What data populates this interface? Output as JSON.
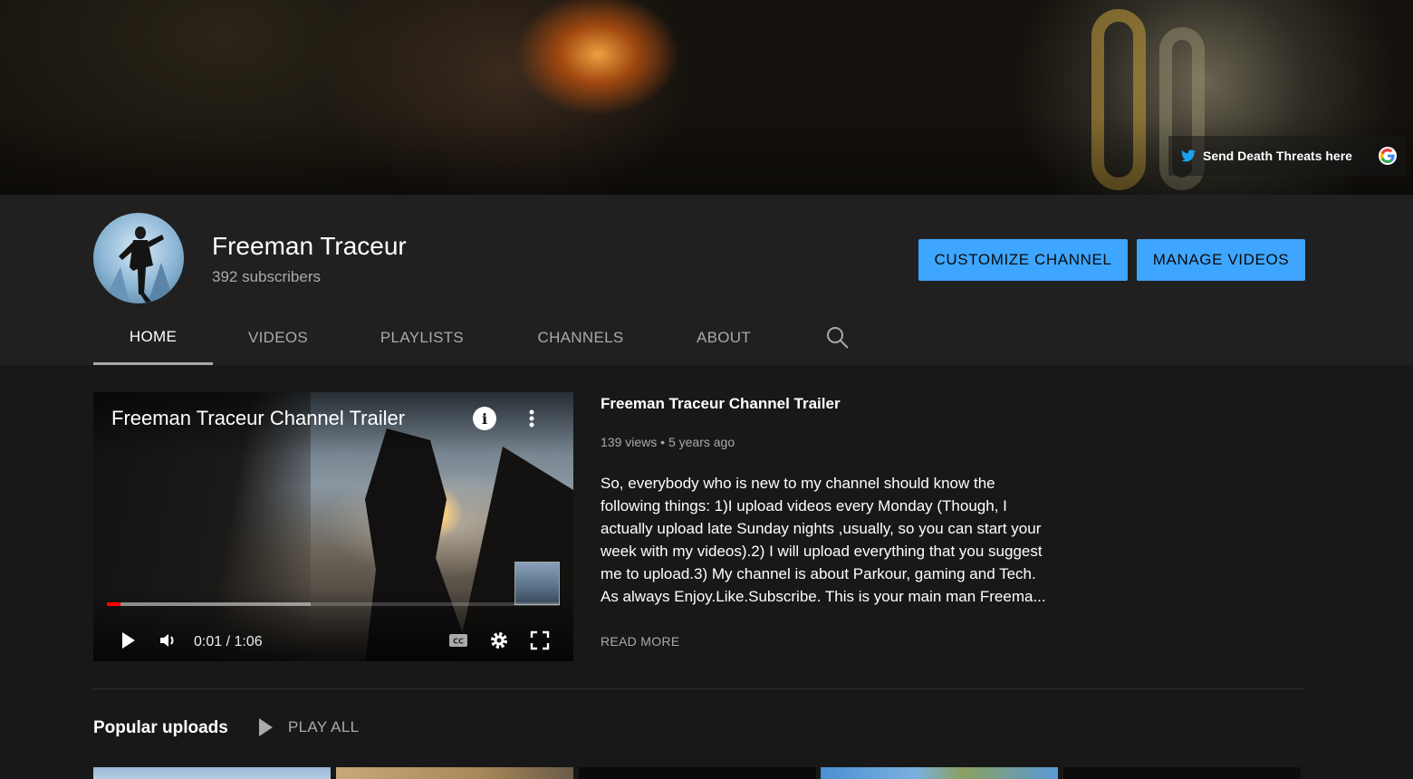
{
  "banner": {
    "link_label": "Send Death Threats here"
  },
  "channel": {
    "name": "Freeman Traceur",
    "subscribers": "392 subscribers"
  },
  "buttons": {
    "customize": "CUSTOMIZE CHANNEL",
    "manage": "MANAGE VIDEOS"
  },
  "tabs": [
    {
      "label": "HOME",
      "active": true
    },
    {
      "label": "VIDEOS",
      "active": false
    },
    {
      "label": "PLAYLISTS",
      "active": false
    },
    {
      "label": "CHANNELS",
      "active": false
    },
    {
      "label": "ABOUT",
      "active": false
    }
  ],
  "player": {
    "title": "Freeman Traceur Channel Trailer",
    "time": "0:01 / 1:06",
    "played_fraction": 0.03,
    "loaded_fraction": 0.45
  },
  "trailer": {
    "title": "Freeman Traceur Channel Trailer",
    "views": "139 views",
    "age": "5 years ago",
    "description_1": "So, everybody who is new to my channel should know the following things: 1)I upload videos every Monday (Though, I actually upload late Sunday nights ,usually, so you can start your week with my videos).2) I will upload everything that you suggest me to upload.3) My channel is about Parkour, gaming and Tech.",
    "description_2": "As always Enjoy.Like.Subscribe. This is your main man Freema...",
    "read_more": "READ MORE"
  },
  "popular": {
    "title": "Popular uploads",
    "play_all": "PLAY ALL"
  },
  "colors": {
    "accent": "#3ea6ff",
    "background": "#181818",
    "header": "#202020",
    "progress": "#ff0000"
  }
}
